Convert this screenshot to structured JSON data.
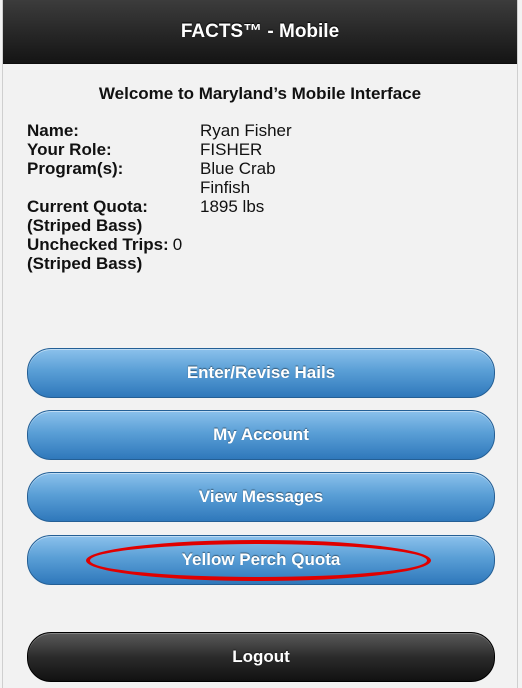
{
  "header": {
    "title": "FACTS™ - Mobile"
  },
  "welcome": "Welcome to Maryland’s Mobile Interface",
  "profile": {
    "name_label": "Name:",
    "name_value": "Ryan Fisher",
    "role_label": "Your Role:",
    "role_value": "FISHER",
    "programs_label": "Program(s):",
    "programs": [
      "Blue Crab",
      "Finfish"
    ],
    "quota_label": "Current Quota:",
    "quota_value": "1895 lbs",
    "quota_sub": "(Striped Bass)",
    "trips_label": "Unchecked Trips:",
    "trips_value": "0",
    "trips_sub": "(Striped Bass)"
  },
  "buttons": {
    "hails": "Enter/Revise Hails",
    "account": "My Account",
    "messages": "View Messages",
    "perch": "Yellow Perch Quota",
    "logout": "Logout"
  },
  "colors": {
    "primary_button": "#4a90cf",
    "logout_button": "#2b2b2b",
    "highlight": "#e00000"
  }
}
